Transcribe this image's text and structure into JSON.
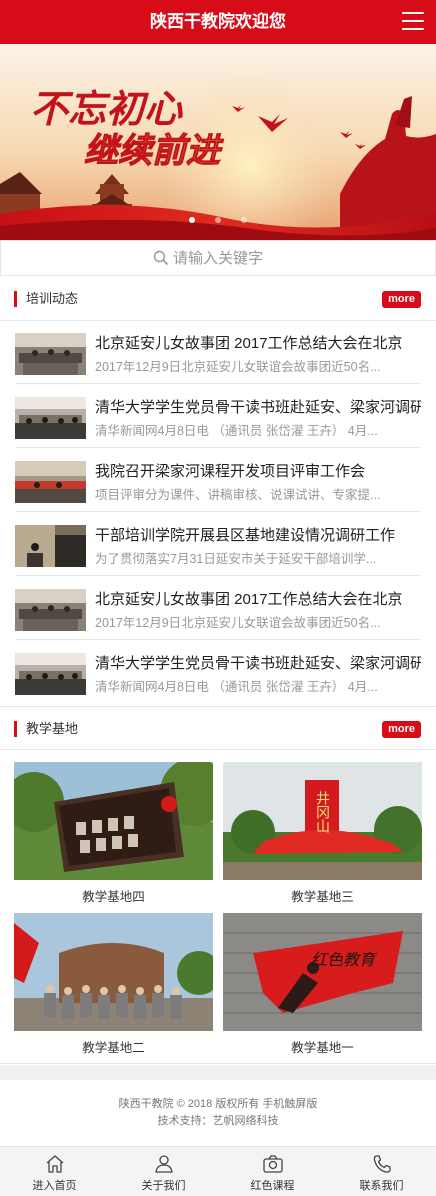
{
  "header": {
    "title": "陕西干教院欢迎您",
    "menu_icon": "hamburger-icon"
  },
  "banner": {
    "slogan_line1": "不忘初心",
    "slogan_line2": "继续前进",
    "slide_count": 3,
    "active_slide": 1
  },
  "search": {
    "placeholder": "请输入关键字",
    "icon": "search-icon"
  },
  "training": {
    "label": "培训动态",
    "more": "more",
    "items": [
      {
        "title": "北京延安儿女故事团 2017工作总结大会在北京",
        "desc": "2017年12月9日北京延安儿女联谊会故事团近50名..."
      },
      {
        "title": "清华大学学生党员骨干读书班赴延安、梁家河调研",
        "desc": "清华新闻网4月8日电 （通讯员 张岱濯 王卉） 4月..."
      },
      {
        "title": "我院召开梁家河课程开发项目评审工作会",
        "desc": "项目评审分为课件、讲稿审核、说课试讲、专家提..."
      },
      {
        "title": "干部培训学院开展县区基地建设情况调研工作",
        "desc": "为了贯彻落实7月31日延安市关于延安干部培训学..."
      },
      {
        "title": "北京延安儿女故事团 2017工作总结大会在北京",
        "desc": "2017年12月9日北京延安儿女联谊会故事团近50名..."
      },
      {
        "title": "清华大学学生党员骨干读书班赴延安、梁家河调研",
        "desc": "清华新闻网4月8日电 （通讯员 张岱濯 王卉） 4月..."
      }
    ]
  },
  "bases": {
    "label": "教学基地",
    "more": "more",
    "items": [
      {
        "caption": "教学基地四"
      },
      {
        "caption": "教学基地三"
      },
      {
        "caption": "教学基地二"
      },
      {
        "caption": "教学基地一"
      }
    ],
    "sign_text_1": "井冈山",
    "sign_text_2": "红色教育"
  },
  "footer": {
    "copyright": "陕西干教院 © 2018 版权所有 手机触屏版",
    "support": "技术支持：艺帆网络科技"
  },
  "tabbar": [
    {
      "label": "进入首页",
      "icon": "home-icon"
    },
    {
      "label": "关于我们",
      "icon": "user-icon"
    },
    {
      "label": "红色课程",
      "icon": "camera-icon"
    },
    {
      "label": "联系我们",
      "icon": "phone-icon"
    }
  ],
  "colors": {
    "brand_red": "#d80c18",
    "muted_text": "#999999"
  }
}
